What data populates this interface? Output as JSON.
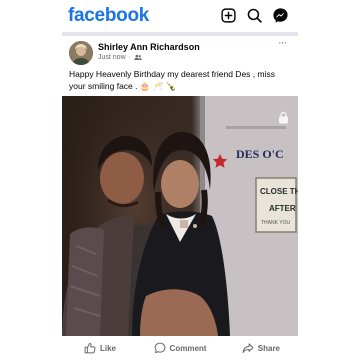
{
  "app": {
    "logo_text": "facebook",
    "brand_color": "#1b74e4"
  },
  "header": {
    "icons": [
      "add-icon",
      "search-icon",
      "messenger-icon"
    ]
  },
  "post": {
    "author": "Shirley Ann Richardson",
    "time": "Just now",
    "separator": "·",
    "audience_icon": "friends-icon",
    "more_label": "···",
    "text": "Happy Heavenly Birthday my dearest friend Des , miss your smiling face . 🎂 🥂 🍾",
    "photo": {
      "sign_line_1": "DES O'C",
      "sign_line_2": "CLOSE TH",
      "sign_line_3": "AFTER",
      "sign_line_4": "THANK YOU",
      "lock_icon": "lock-icon"
    }
  },
  "actions": {
    "like": "Like",
    "comment": "Comment",
    "share": "Share"
  }
}
